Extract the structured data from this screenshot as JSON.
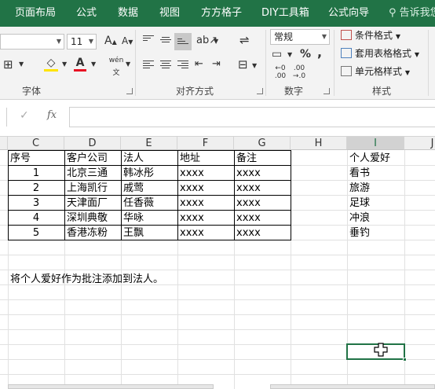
{
  "ribbon_tabs": [
    "页面布局",
    "公式",
    "数据",
    "视图",
    "方方格子",
    "DIY工具箱",
    "公式向导"
  ],
  "tell_me": "告诉我您",
  "font": {
    "size": "11",
    "group_label": "字体",
    "phonetic": "wén"
  },
  "alignment": {
    "group_label": "对齐方式"
  },
  "number": {
    "format": "常规",
    "percent": "%",
    "comma": ",",
    "inc_decimal": "←.0 .00",
    "dec_decimal": ".00 →.0",
    "group_label": "数字"
  },
  "styles": {
    "conditional": "条件格式",
    "table_format": "套用表格格式",
    "cell_style": "单元格样式",
    "group_label": "样式"
  },
  "formula_bar": {
    "fx": "fx",
    "value": ""
  },
  "columns": [
    "C",
    "D",
    "E",
    "F",
    "G",
    "H",
    "I",
    "J"
  ],
  "table": {
    "headers": [
      "序号",
      "客户公司",
      "法人",
      "地址",
      "备注"
    ],
    "rows": [
      [
        "1",
        "北京三通",
        "韩冰彤",
        "xxxx",
        "xxxx"
      ],
      [
        "2",
        "上海凯行",
        "戚莺",
        "xxxx",
        "xxxx"
      ],
      [
        "3",
        "天津面厂",
        "任香薇",
        "xxxx",
        "xxxx"
      ],
      [
        "4",
        "深圳典敬",
        "华咏",
        "xxxx",
        "xxxx"
      ],
      [
        "5",
        "香港冻粉",
        "王飘",
        "xxxx",
        "xxxx"
      ]
    ]
  },
  "hobbies": {
    "header": "个人爱好",
    "values": [
      "看书",
      "旅游",
      "足球",
      "冲浪",
      "垂钓"
    ]
  },
  "instruction": "将个人爱好作为批注添加到法人。",
  "colors": {
    "excel_green": "#217346",
    "ribbon_bg": "#f3f3f3"
  }
}
